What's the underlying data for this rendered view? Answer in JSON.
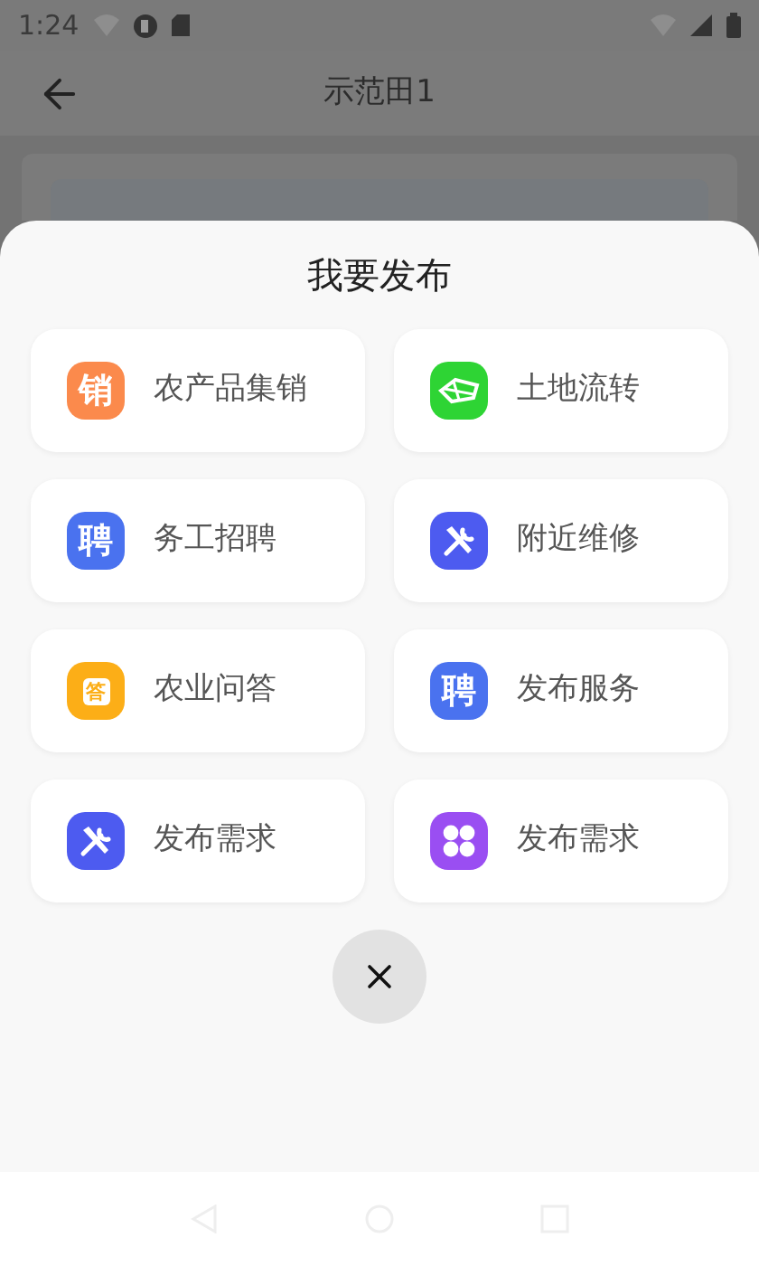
{
  "status_bar": {
    "time": "1:24"
  },
  "header": {
    "title": "示范田1"
  },
  "sheet": {
    "title": "我要发布",
    "items": [
      {
        "label": "农产品集销",
        "kind": "glyph",
        "glyph": "销",
        "color": "#fb8a4c"
      },
      {
        "label": "土地流转",
        "kind": "land",
        "color": "#2ed434"
      },
      {
        "label": "务工招聘",
        "kind": "glyph",
        "glyph": "聘",
        "color": "#4a72ef"
      },
      {
        "label": "附近维修",
        "kind": "tools",
        "color": "#4d5bf0"
      },
      {
        "label": "农业问答",
        "kind": "answer",
        "glyph": "答",
        "color": "#fcae17"
      },
      {
        "label": "发布服务",
        "kind": "glyph",
        "glyph": "聘",
        "color": "#4a72ef"
      },
      {
        "label": "发布需求",
        "kind": "tools",
        "color": "#4d5bf0"
      },
      {
        "label": "发布需求",
        "kind": "grid",
        "color": "#9a4ef2"
      }
    ]
  }
}
